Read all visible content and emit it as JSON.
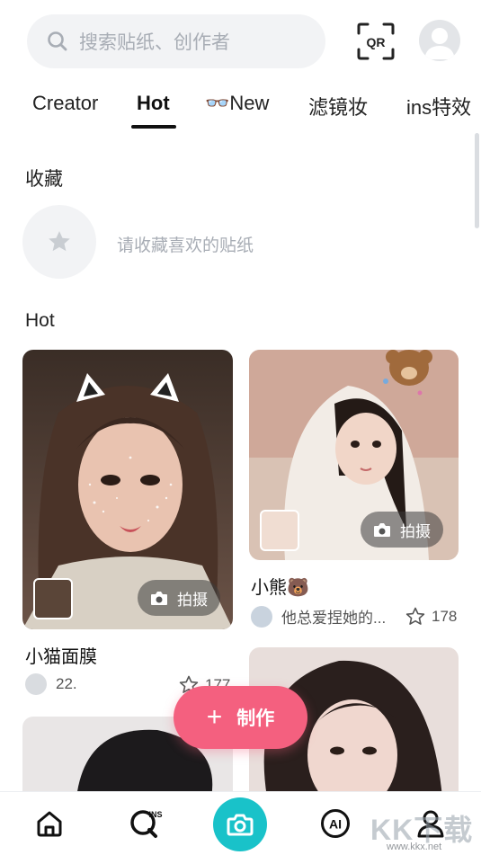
{
  "search": {
    "placeholder": "搜索贴纸、创作者",
    "icon": "search-icon"
  },
  "header": {
    "qr_label": "QR"
  },
  "tabs": [
    {
      "label": "Creator"
    },
    {
      "label": "Hot",
      "active": true
    },
    {
      "label": "👓New"
    },
    {
      "label": "滤镜妆"
    },
    {
      "label": "ins特效"
    }
  ],
  "favorites": {
    "title": "收藏",
    "hint": "请收藏喜欢的贴纸"
  },
  "hot": {
    "title": "Hot",
    "cards": [
      {
        "title": "小猫面膜",
        "author": "22.",
        "likes": "177",
        "shoot_label": "拍摄"
      },
      {
        "title": "小熊🐻",
        "author": "他总爱捏她的...",
        "likes": "178",
        "shoot_label": "拍摄"
      }
    ]
  },
  "make_button": {
    "label": "制作"
  },
  "bottom_nav": {
    "items": [
      "home",
      "ins",
      "camera",
      "ai",
      "profile"
    ],
    "accent": "#19c2c9"
  },
  "watermark": {
    "main": "KK下载",
    "url": "www.kkx.net"
  },
  "colors": {
    "accent_pink": "#f4607f",
    "accent_teal": "#19c2c9"
  }
}
